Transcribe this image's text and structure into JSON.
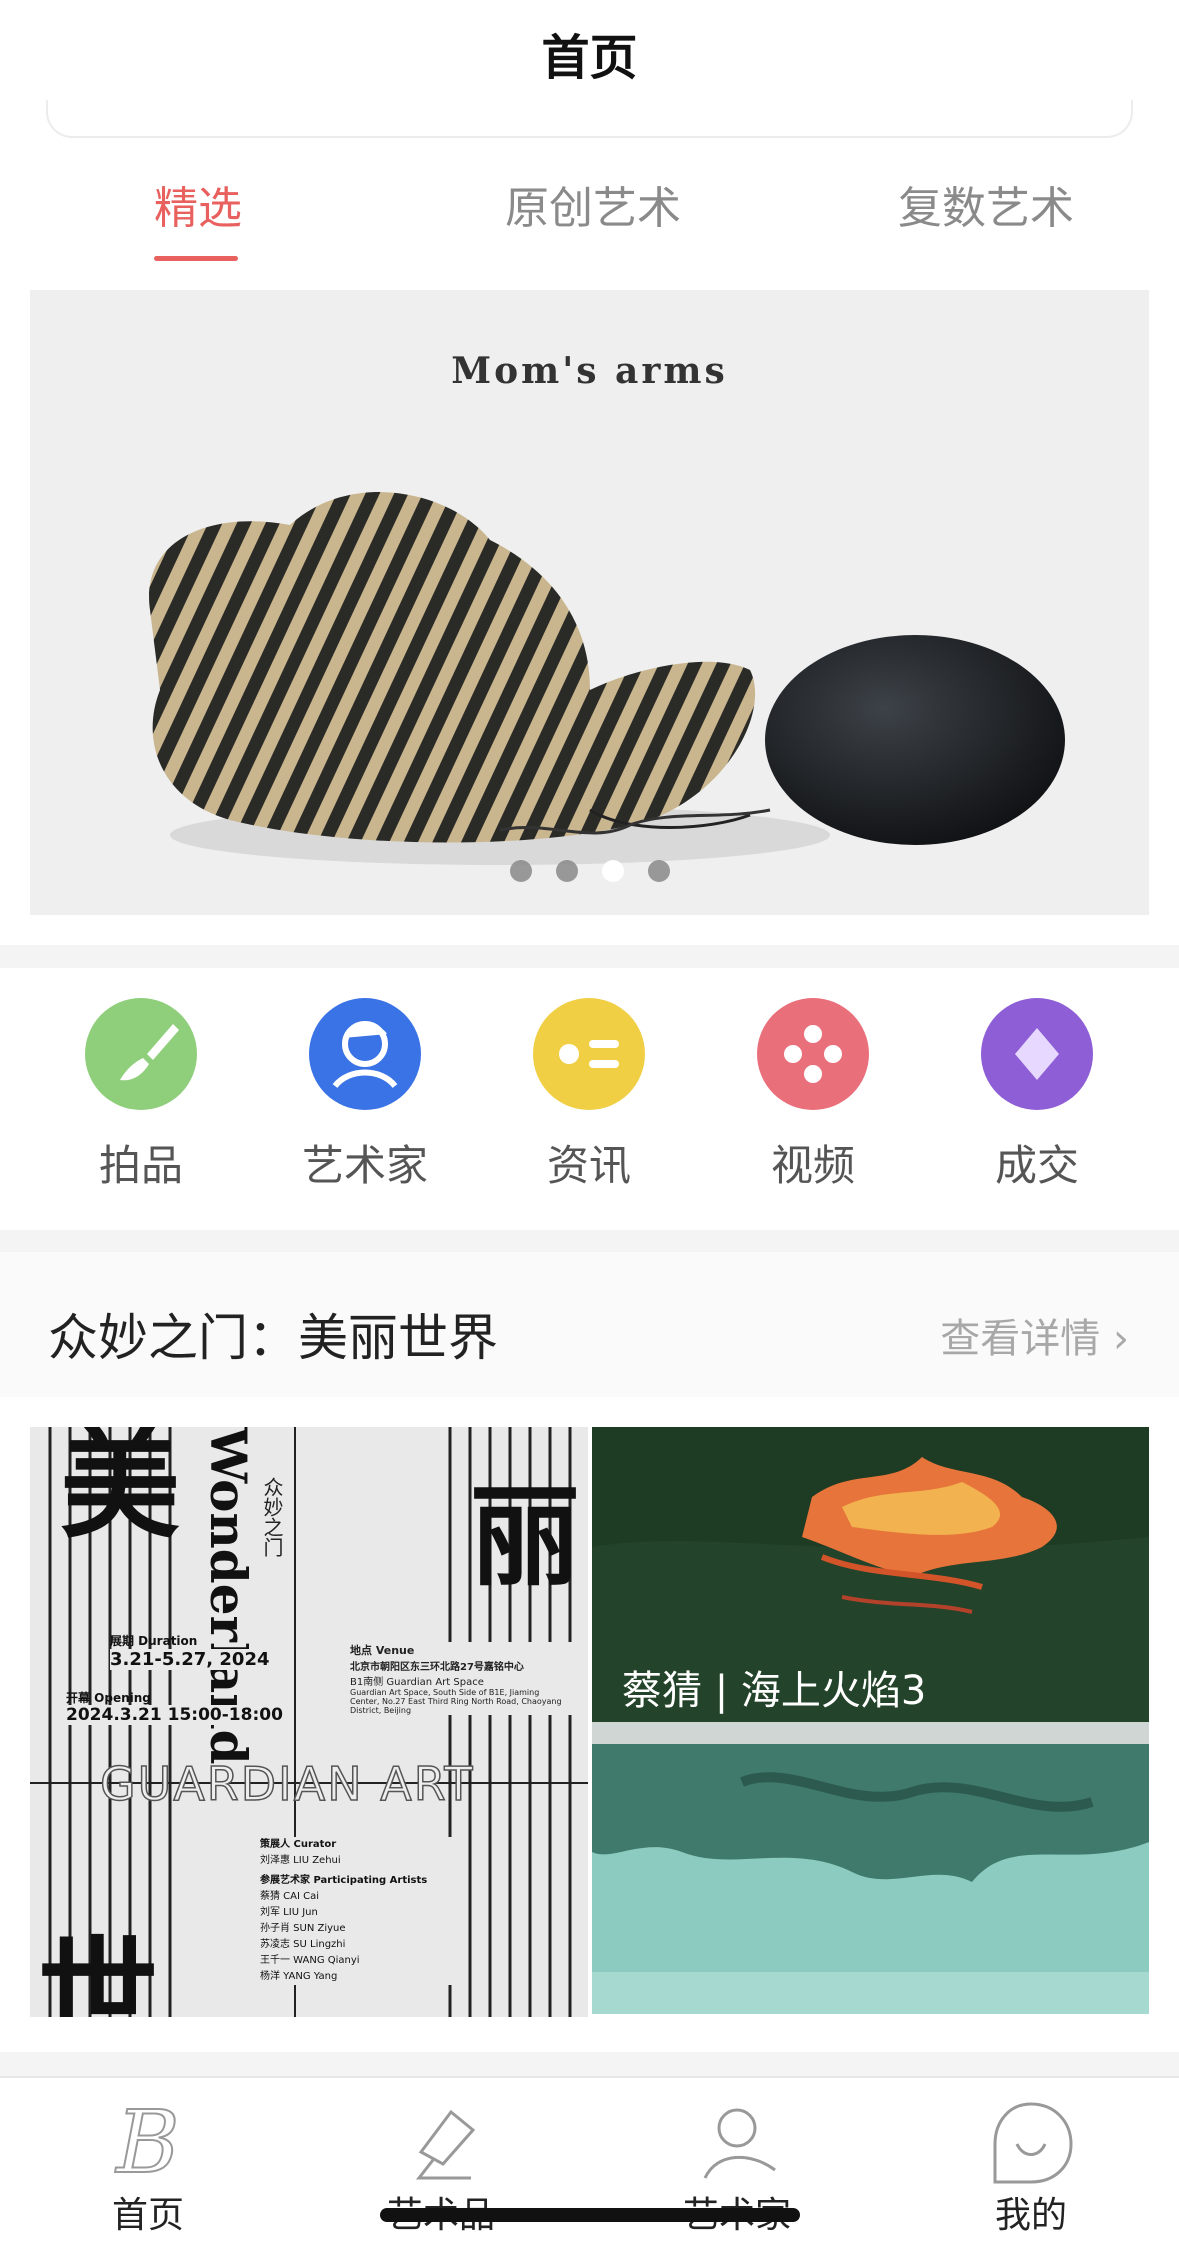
{
  "nav": {
    "title": "首页"
  },
  "tabs": [
    {
      "label": "精选",
      "active": true
    },
    {
      "label": "原创艺术",
      "active": false
    },
    {
      "label": "复数艺术",
      "active": false
    }
  ],
  "banner": {
    "caption": "Mom's arms",
    "dots": 4,
    "active_dot": 3
  },
  "quick_links": [
    {
      "label": "拍品",
      "icon": "brush-icon",
      "color": "#8fcf7b"
    },
    {
      "label": "艺术家",
      "icon": "artist-avatar-icon",
      "color": "#3a73e6"
    },
    {
      "label": "资讯",
      "icon": "news-icon",
      "color": "#f0cf45"
    },
    {
      "label": "视频",
      "icon": "video-icon",
      "color": "#e9707b"
    },
    {
      "label": "成交",
      "icon": "deal-diamond-icon",
      "color": "#8e5ed6"
    }
  ],
  "section": {
    "title": "众妙之门：美丽世界",
    "more_label": "查看详情",
    "poster": {
      "big_char_top_left": "美",
      "big_char_top_right": "丽",
      "big_char_bottom": "世",
      "vertical_title": "Wonderland",
      "sub_vertical": "众妙之门",
      "duration_label": "展期 Duration",
      "duration_value": "3.21-5.27, 2024",
      "opening_label": "开幕 Opening",
      "opening_value": "2024.3.21  15:00-18:00",
      "venue_label": "地点 Venue",
      "venue_lines": [
        "北京市朝阳区东三环北路27号嘉铭中心",
        "B1南侧 Guardian Art Space",
        "Guardian Art Space, South Side of B1E, Jiaming",
        "Center, No.27 East Third Ring North Road, Chaoyang",
        "District, Beijing"
      ],
      "brand": "GUARDIAN ART",
      "curator_label": "策展人 Curator",
      "curator_value": "刘泽惠  LIU Zehui",
      "artists_label": "参展艺术家 Participating Artists",
      "artists": [
        "蔡猜  CAI Cai",
        "刘军  LIU Jun",
        "孙子肖  SUN Ziyue",
        "苏凌志  SU Lingzhi",
        "王千一  WANG Qianyi",
        "杨洋  YANG Yang"
      ]
    },
    "painting_1_caption": "蔡猜 | 海上火焰3",
    "painting_2_caption": ""
  },
  "tabbar": [
    {
      "label": "首页",
      "icon": "home-b-icon"
    },
    {
      "label": "艺术品",
      "icon": "artwork-hammer-icon"
    },
    {
      "label": "艺术家",
      "icon": "artist-person-icon"
    },
    {
      "label": "我的",
      "icon": "profile-smile-icon"
    }
  ]
}
